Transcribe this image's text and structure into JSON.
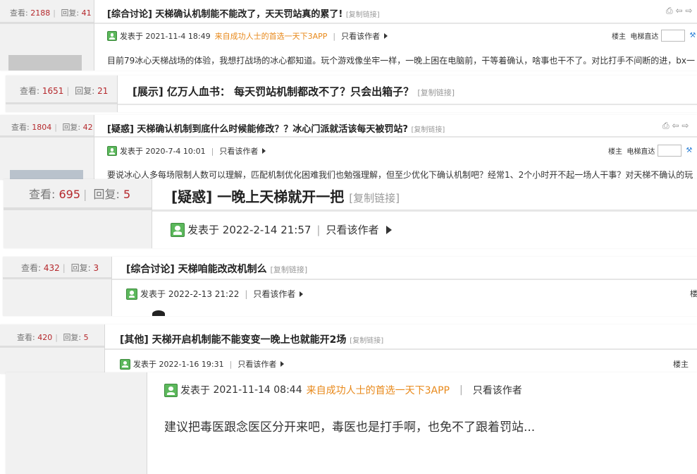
{
  "labels": {
    "views": "查看:",
    "replies": "回复:",
    "copy_link": "[复制链接]",
    "posted_at": "发表于",
    "only_author": "只看该作者",
    "floor_owner": "楼主",
    "floor_owner_cut": "楼",
    "elevator": "电梯直达"
  },
  "icons": {
    "print": "print-icon",
    "prev": "prev-thread-icon",
    "next": "next-thread-icon",
    "wrench": "wrench-icon",
    "dropdown": "triangle-right-icon"
  },
  "threads": [
    {
      "views": "2188",
      "replies": "41",
      "title": "[综合讨论] 天梯确认机制能不能改了，天天罚站真的累了!",
      "date": "2021-11-4 18:49",
      "promo": "来自成功人士的首选一天下3APP",
      "body": "目前79冰心天梯战场的体验，我想打战场的冰心都知道。玩个游戏像坐牢一样，一晚上困在电脑前，干等着确认，啥事也干不了。对比打手不间断的进，bx一"
    },
    {
      "views": "1651",
      "replies": "21",
      "title": "[展示] 亿万人血书： 每天罚站机制都改不了？只会出箱子？"
    },
    {
      "views": "1804",
      "replies": "42",
      "title": "[疑惑] 天梯确认机制到底什么时候能修改？？冰心门派就活该每天被罚站?",
      "date": "2020-7-4 10:01",
      "body": "要说冰心人多每场限制人数可以理解，匹配机制优化困难我们也勉强理解，但至少优化下确认机制吧？经常1、2个小时开不起一场人干事？对天梯不确认的玩"
    },
    {
      "views": "695",
      "replies": "5",
      "title": "[疑惑] 一晚上天梯就开一把",
      "date": "2022-2-14 21:57"
    },
    {
      "views": "432",
      "replies": "3",
      "title": "[综合讨论] 天梯咱能改改机制么",
      "date": "2022-2-13 21:22"
    },
    {
      "views": "420",
      "replies": "5",
      "title": "[其他] 天梯开启机制能不能变变一晚上也就能开2场",
      "date": "2022-1-16 19:31"
    }
  ],
  "reply": {
    "date": "2021-11-14 08:44",
    "promo": "来自成功人士的首选一天下3APP",
    "body": "建议把毒医跟念医区分开来吧，毒医也是打手啊，也免不了跟着罚站..."
  }
}
